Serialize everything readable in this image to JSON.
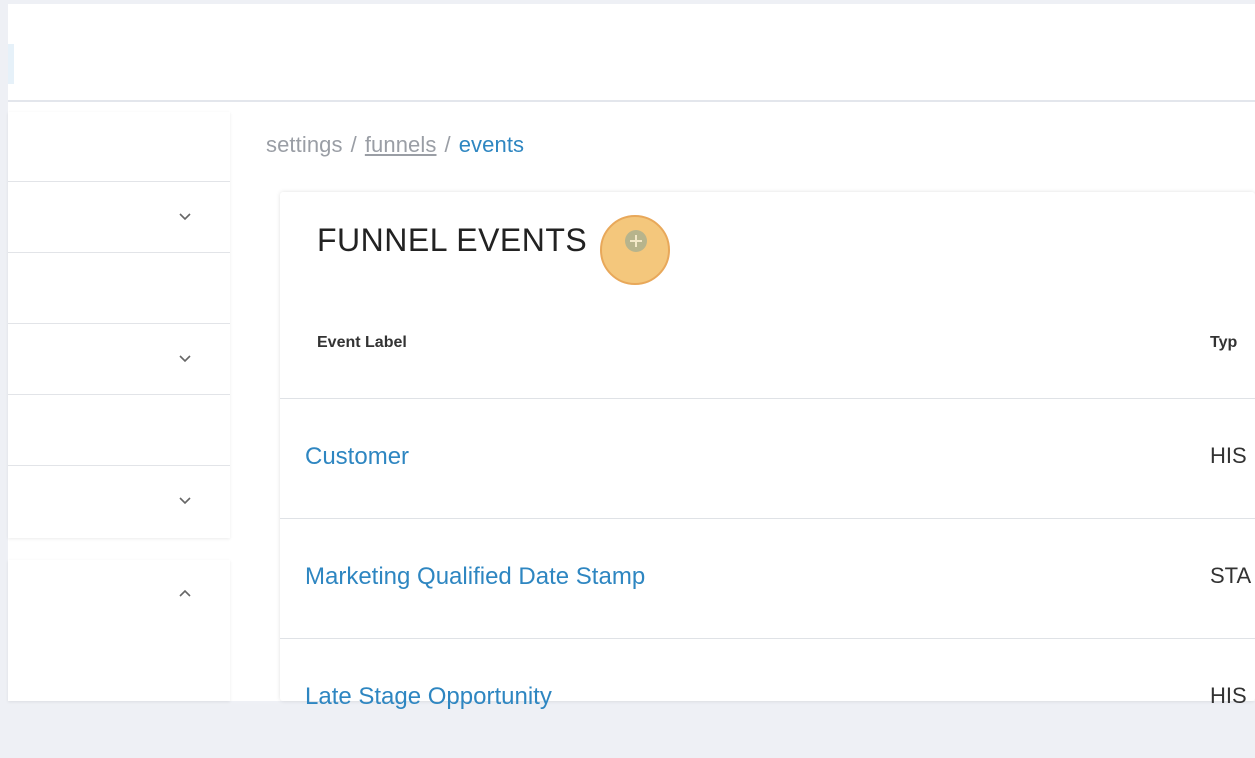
{
  "breadcrumb": {
    "items": [
      "settings",
      "funnels",
      "events"
    ],
    "separator": "/"
  },
  "card": {
    "title": "FUNNEL EVENTS",
    "add_icon": "plus-circle-icon",
    "columns": [
      "Event Label",
      "Typ"
    ]
  },
  "rows": [
    {
      "label": "Customer",
      "type": "HIS"
    },
    {
      "label": "Marketing Qualified Date Stamp",
      "type": "STA"
    },
    {
      "label": "Late Stage Opportunity",
      "type": "HIS"
    }
  ],
  "sidebar": {
    "chevrons": [
      "chevron-down-icon",
      "chevron-down-icon",
      "chevron-down-icon",
      "chevron-up-icon"
    ]
  },
  "colors": {
    "link": "#2e86c1",
    "highlight": "#f0b450"
  }
}
